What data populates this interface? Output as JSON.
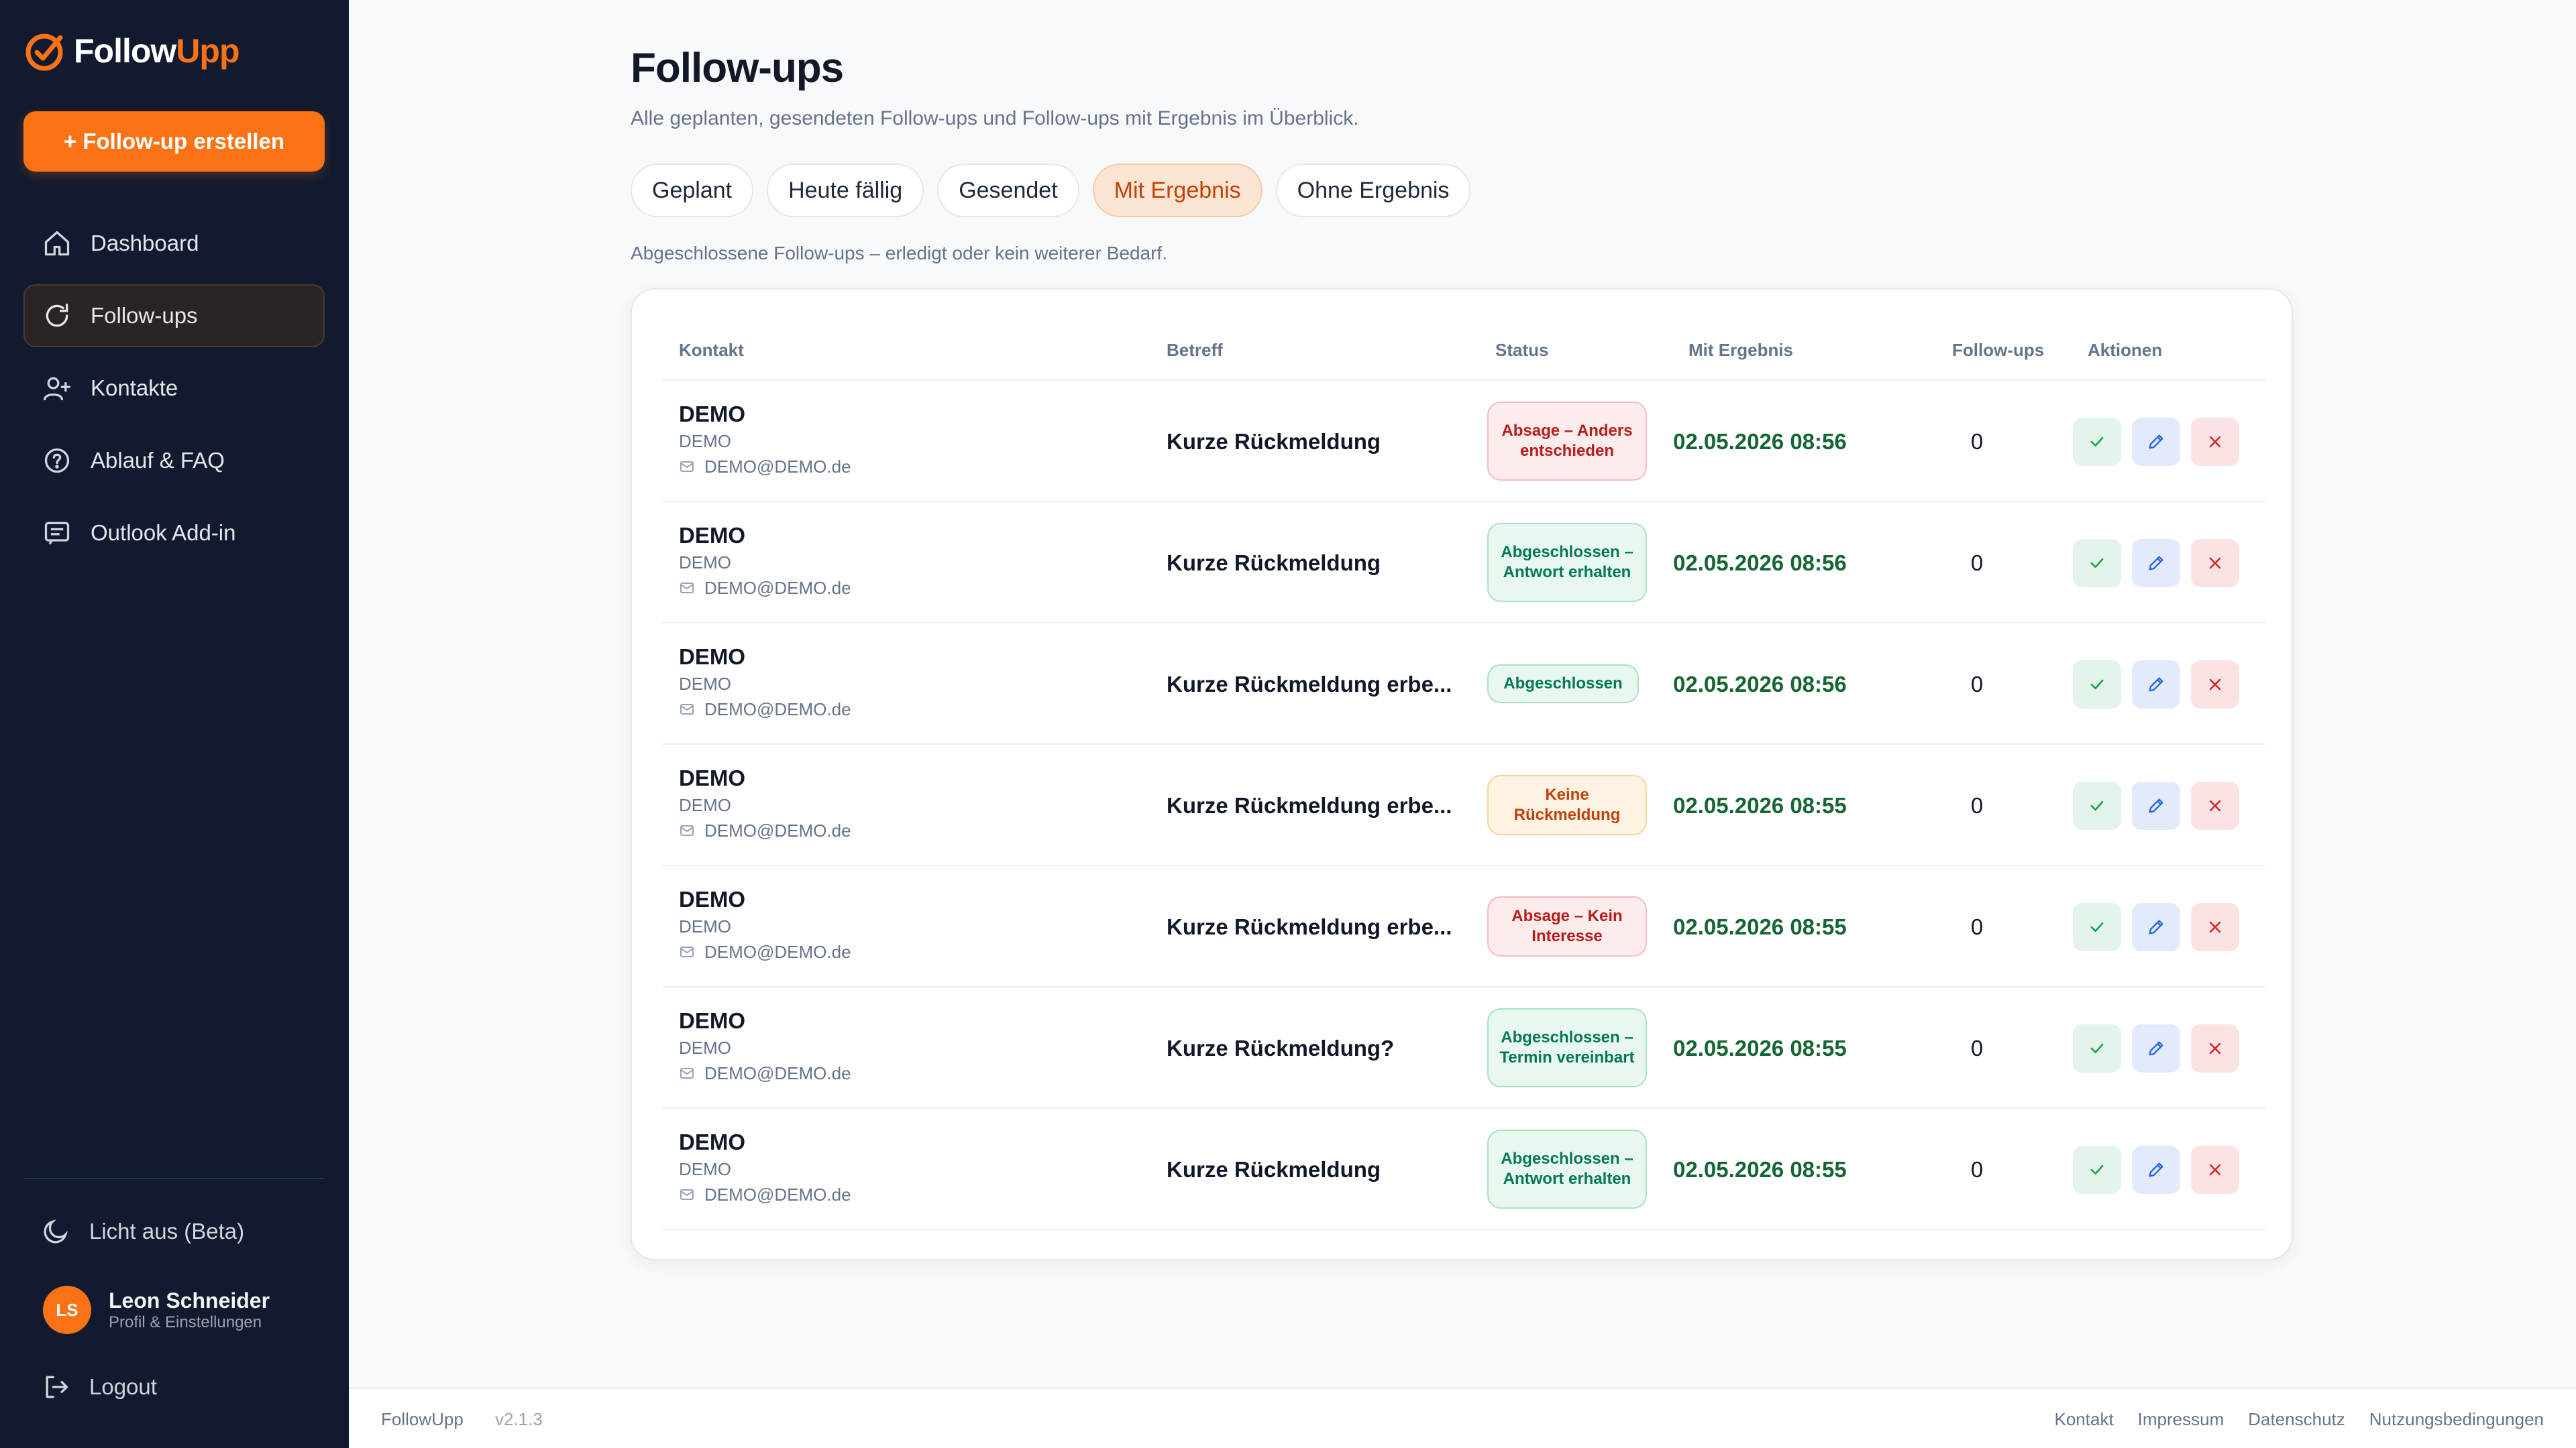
{
  "brand": {
    "name_part1": "Follow",
    "name_part2": "Upp",
    "accent": "#f97316"
  },
  "sidebar": {
    "create_label": "+ Follow-up erstellen",
    "items": [
      {
        "label": "Dashboard",
        "icon": "home-icon"
      },
      {
        "label": "Follow-ups",
        "icon": "refresh-icon",
        "active": true
      },
      {
        "label": "Kontakte",
        "icon": "user-plus-icon"
      },
      {
        "label": "Ablauf & FAQ",
        "icon": "help-circle-icon"
      },
      {
        "label": "Outlook Add-in",
        "icon": "message-icon"
      }
    ],
    "theme_label": "Licht aus (Beta)",
    "user": {
      "initials": "LS",
      "name": "Leon Schneider",
      "sub": "Profil & Einstellungen"
    },
    "logout_label": "Logout"
  },
  "page": {
    "title": "Follow-ups",
    "subtitle": "Alle geplanten, gesendeten Follow-ups und Follow-ups mit Ergebnis im Überblick.",
    "tabs": [
      {
        "label": "Geplant"
      },
      {
        "label": "Heute fällig"
      },
      {
        "label": "Gesendet"
      },
      {
        "label": "Mit Ergebnis",
        "active": true
      },
      {
        "label": "Ohne Ergebnis"
      }
    ],
    "tab_description": "Abgeschlossene Follow-ups – erledigt oder kein weiterer Bedarf."
  },
  "table": {
    "headers": {
      "contact": "Kontakt",
      "subject": "Betreff",
      "status": "Status",
      "result": "Mit Ergebnis",
      "followups": "Follow-ups",
      "actions": "Aktionen"
    },
    "rows": [
      {
        "name": "DEMO",
        "company": "DEMO",
        "email": "DEMO@DEMO.de",
        "subject": "Kurze Rückmeldung",
        "status": "Absage – Anders entschieden",
        "status_color": "red",
        "date": "02.05.2026 08:56",
        "count": "0"
      },
      {
        "name": "DEMO",
        "company": "DEMO",
        "email": "DEMO@DEMO.de",
        "subject": "Kurze Rückmeldung",
        "status": "Abgeschlossen – Antwort erhalten",
        "status_color": "green",
        "date": "02.05.2026 08:56",
        "count": "0"
      },
      {
        "name": "DEMO",
        "company": "DEMO",
        "email": "DEMO@DEMO.de",
        "subject": "Kurze Rückmeldung erbe...",
        "status": "Abgeschlossen",
        "status_color": "green",
        "date": "02.05.2026 08:56",
        "count": "0"
      },
      {
        "name": "DEMO",
        "company": "DEMO",
        "email": "DEMO@DEMO.de",
        "subject": "Kurze Rückmeldung erbe...",
        "status": "Keine Rückmeldung",
        "status_color": "orange",
        "date": "02.05.2026 08:55",
        "count": "0"
      },
      {
        "name": "DEMO",
        "company": "DEMO",
        "email": "DEMO@DEMO.de",
        "subject": "Kurze Rückmeldung erbe...",
        "status": "Absage – Kein Interesse",
        "status_color": "red",
        "date": "02.05.2026 08:55",
        "count": "0"
      },
      {
        "name": "DEMO",
        "company": "DEMO",
        "email": "DEMO@DEMO.de",
        "subject": "Kurze Rückmeldung?",
        "status": "Abgeschlossen – Termin vereinbart",
        "status_color": "green",
        "date": "02.05.2026 08:55",
        "count": "0"
      },
      {
        "name": "DEMO",
        "company": "DEMO",
        "email": "DEMO@DEMO.de",
        "subject": "Kurze Rückmeldung",
        "status": "Abgeschlossen – Antwort erhalten",
        "status_color": "green",
        "date": "02.05.2026 08:55",
        "count": "0"
      }
    ]
  },
  "footer": {
    "brand": "FollowUpp",
    "version": "v2.1.3",
    "links": [
      "Kontakt",
      "Impressum",
      "Datenschutz",
      "Nutzungsbedingungen"
    ]
  }
}
